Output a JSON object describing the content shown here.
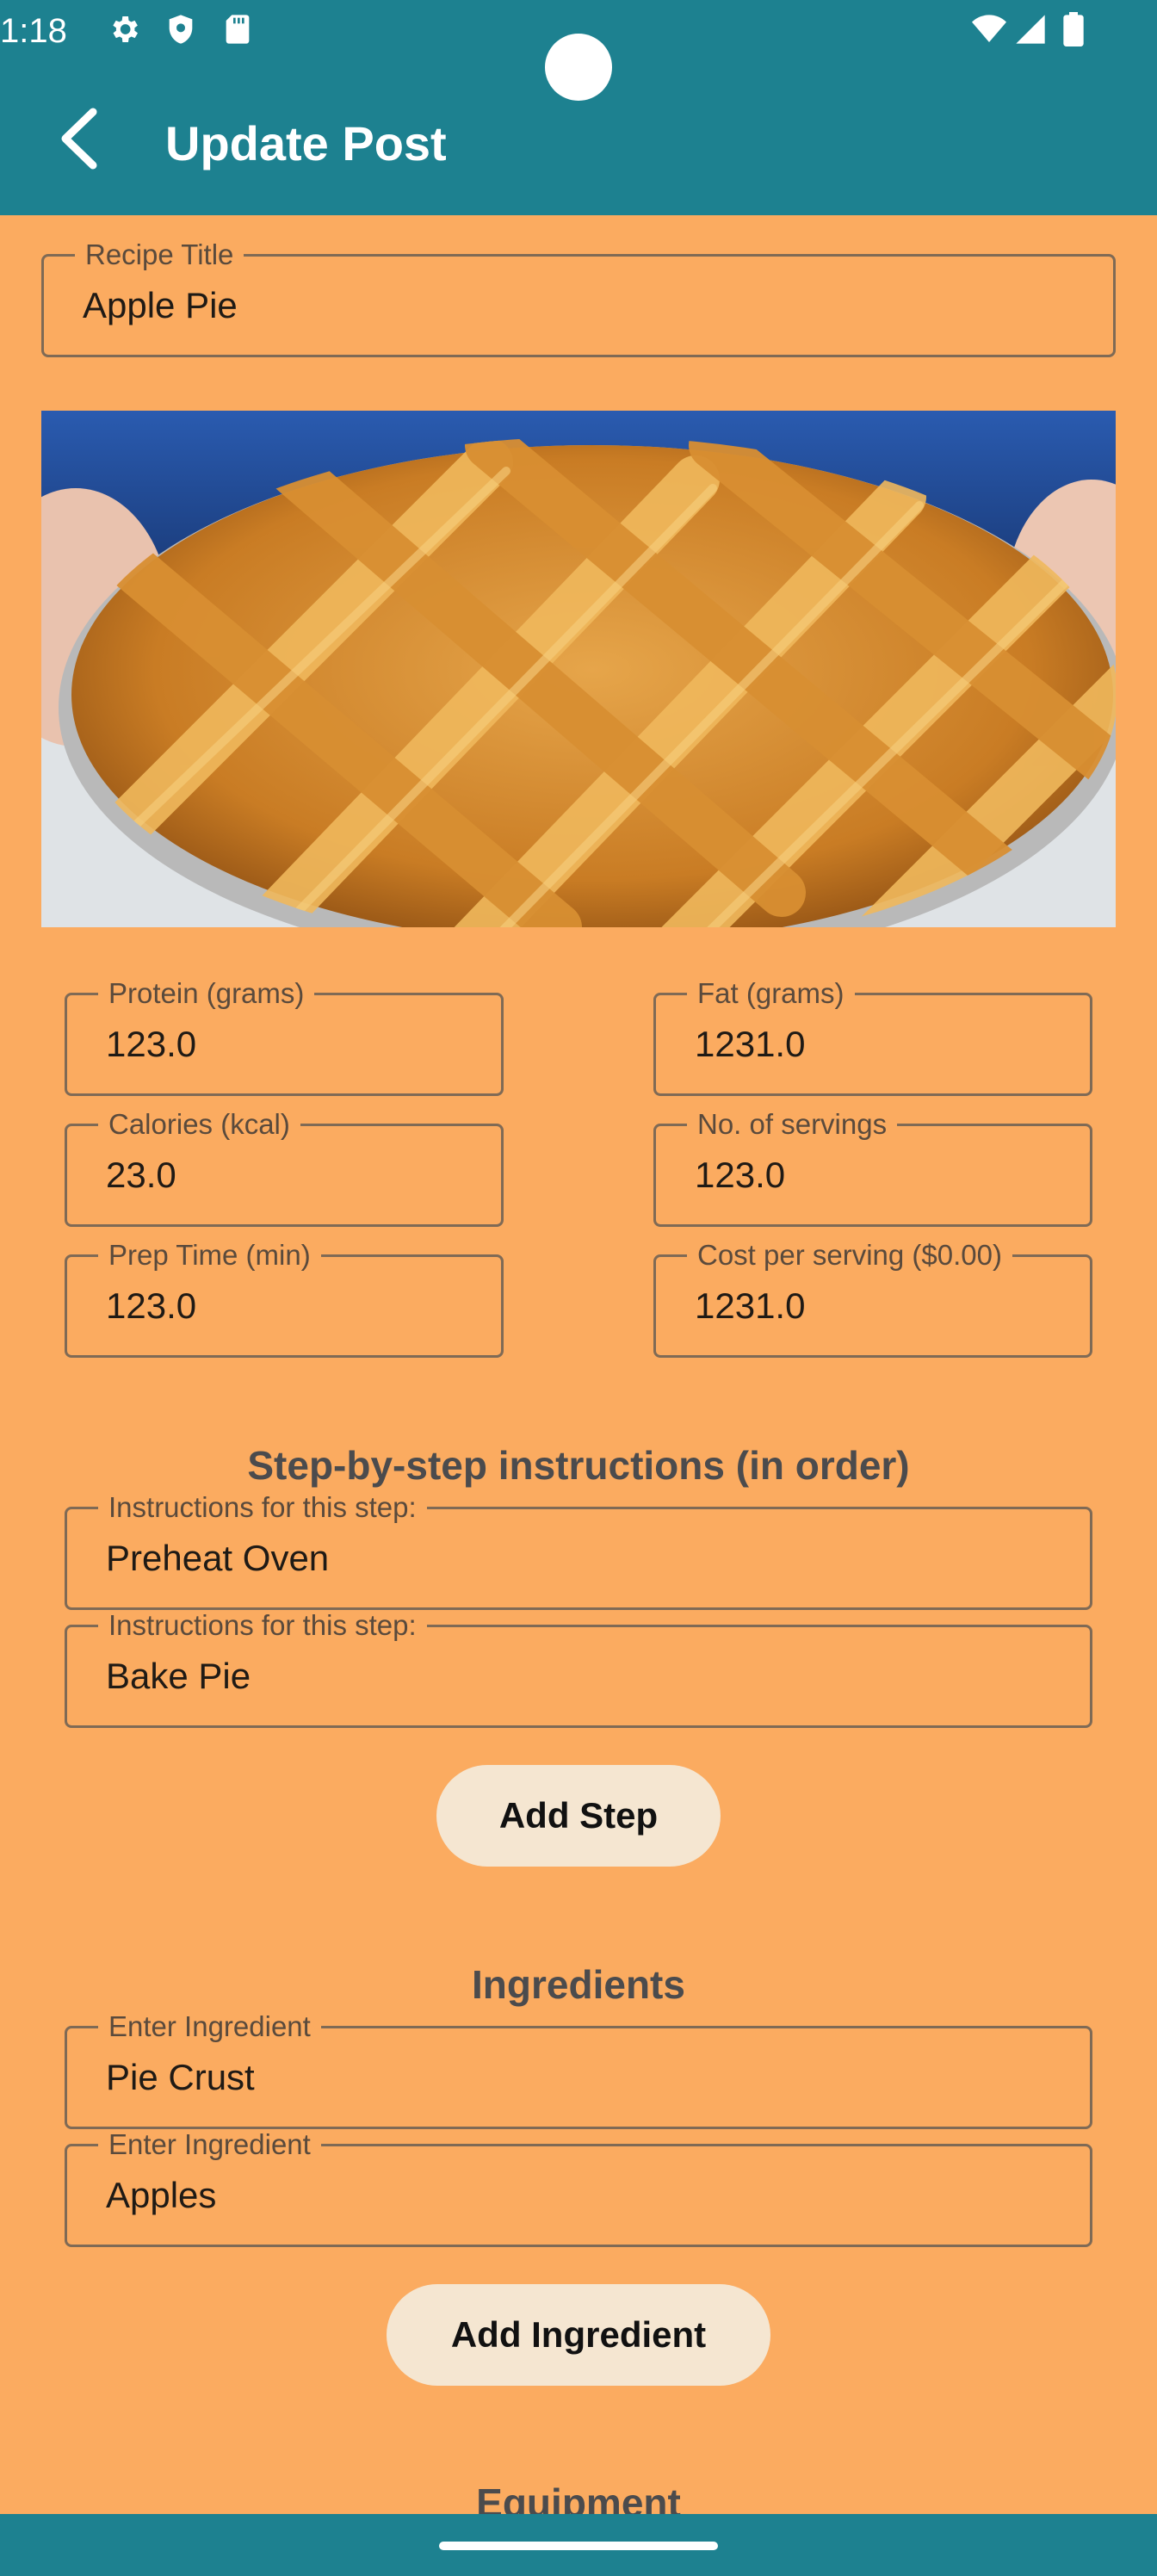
{
  "status_bar": {
    "time": "1:18"
  },
  "app_bar": {
    "title": "Update Post"
  },
  "recipe_title": {
    "label": "Recipe Title",
    "value": "Apple Pie"
  },
  "nutrition": {
    "protein": {
      "label": "Protein (grams)",
      "value": "123.0"
    },
    "fat": {
      "label": "Fat (grams)",
      "value": "1231.0"
    },
    "calories": {
      "label": "Calories (kcal)",
      "value": "23.0"
    },
    "servings": {
      "label": "No. of servings",
      "value": "123.0"
    },
    "prep_time": {
      "label": "Prep Time (min)",
      "value": "123.0"
    },
    "cost": {
      "label": "Cost per serving ($0.00)",
      "value": "1231.0"
    }
  },
  "instructions": {
    "heading": "Step-by-step instructions (in order)",
    "steps": [
      {
        "label": "Instructions for this step:",
        "value": "Preheat Oven"
      },
      {
        "label": "Instructions for this step:",
        "value": "Bake Pie"
      }
    ],
    "add_button": "Add Step"
  },
  "ingredients": {
    "heading": "Ingredients",
    "items": [
      {
        "label": "Enter Ingredient",
        "value": "Pie Crust"
      },
      {
        "label": "Enter Ingredient",
        "value": "Apples"
      }
    ],
    "add_button": "Add Ingredient"
  },
  "equipment": {
    "heading": "Equipment"
  },
  "colors": {
    "app_bar": "#1d8190",
    "background": "#fbab60",
    "button": "#f5e6d1"
  }
}
